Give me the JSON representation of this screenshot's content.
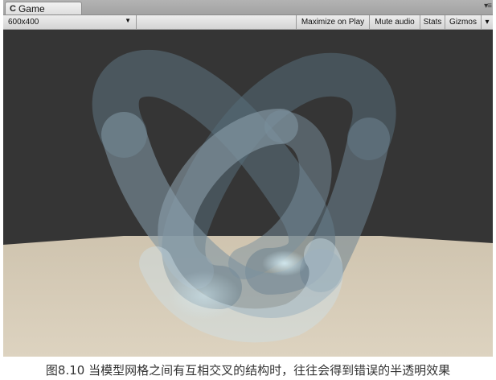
{
  "tab": {
    "icon": "unity-game-icon",
    "icon_glyph": "C",
    "title": "Game",
    "menu_glyph": "▾≡"
  },
  "toolbar": {
    "resolution": "600x400",
    "resolution_arrow": "▼",
    "maximize_label": "Maximize on Play",
    "mute_label": "Mute audio",
    "stats_label": "Stats",
    "gizmos_label": "Gizmos",
    "gizmos_arrow": "▾"
  },
  "scene": {
    "background_color": "#353535",
    "floor_color": "#d2c8b4",
    "knot_color": "#8ea3b0"
  },
  "caption": "图8.10 当模型网格之间有互相交叉的结构时，往往会得到错误的半透明效果"
}
